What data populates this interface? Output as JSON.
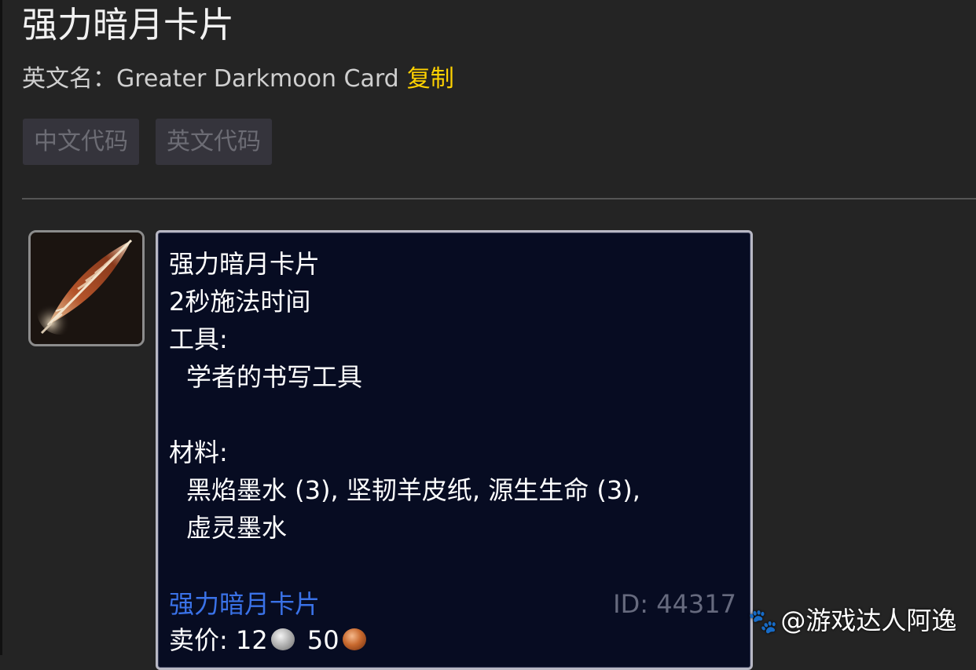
{
  "header": {
    "title": "强力暗月卡片",
    "english_label": "英文名：",
    "english_name": "Greater Darkmoon Card",
    "copy_label": "复制"
  },
  "code_buttons": {
    "chinese": "中文代码",
    "english": "英文代码"
  },
  "item": {
    "icon": "feather-quill-icon",
    "tooltip": {
      "name": "强力暗月卡片",
      "cast_time": "2秒施法时间",
      "tools_label": "工具:",
      "tool": "学者的书写工具",
      "materials_label": "材料:",
      "materials_line1": "黑焰墨水 (3), 坚韧羊皮纸, 源生生命 (3),",
      "materials_line2": "虚灵墨水",
      "result_link": "强力暗月卡片",
      "id_text": "ID: 44317",
      "sell_label": "卖价:",
      "sell_silver": "12",
      "sell_copper": "50"
    }
  },
  "watermark": {
    "text": "@游戏达人阿逸"
  },
  "colors": {
    "background": "#242424",
    "accent_copy": "#ffd200",
    "tooltip_bg": "#070c22",
    "link_blue": "#3a72e8"
  }
}
